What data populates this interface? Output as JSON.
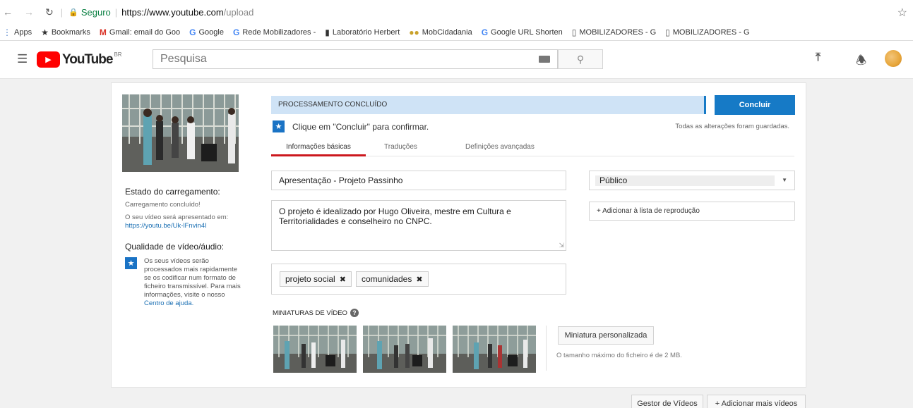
{
  "browser": {
    "secure_label": "Seguro",
    "url_host": "https://www.youtube.com",
    "url_path": "/upload",
    "bookmarks": [
      {
        "icon": "apps-icon",
        "label": "Apps"
      },
      {
        "icon": "star-icon",
        "label": "Bookmarks"
      },
      {
        "icon": "gmail-icon",
        "label": "Gmail: email do Goo"
      },
      {
        "icon": "google-icon",
        "label": "Google"
      },
      {
        "icon": "google-icon",
        "label": "Rede Mobilizadores -"
      },
      {
        "icon": "page-icon",
        "label": "Laboratório Herbert"
      },
      {
        "icon": "people-icon",
        "label": "MobCidadania"
      },
      {
        "icon": "google-icon",
        "label": "Google URL Shorten"
      },
      {
        "icon": "doc-icon",
        "label": "MOBILIZADORES - G"
      },
      {
        "icon": "doc-icon",
        "label": "MOBILIZADORES - G"
      }
    ]
  },
  "header": {
    "logo_text": "YouTube",
    "region": "BR",
    "search_placeholder": "Pesquisa"
  },
  "status": {
    "processing_label": "PROCESSAMENTO CONCLUÍDO",
    "confirm_hint": "Clique em \"Concluir\" para confirmar.",
    "saved_text": "Todas as alterações foram guardadas.",
    "conclude_button": "Concluir"
  },
  "tabs": [
    {
      "label": "Informações básicas",
      "active": true
    },
    {
      "label": "Traduções",
      "active": false
    },
    {
      "label": "Definições avançadas",
      "active": false
    }
  ],
  "sidebar": {
    "upload_state_title": "Estado do carregamento:",
    "upload_state_value": "Carregamento concluído!",
    "video_url_intro": "O seu vídeo será apresentado em:",
    "video_url": "https://youtu.be/Uk-lFnvin4I",
    "quality_title": "Qualidade de vídeo/áudio:",
    "quality_text": "Os seus vídeos serão processados mais rapidamente se os codificar num formato de ficheiro transmissível. Para mais informações, visite o nosso",
    "help_link": "Centro de ajuda."
  },
  "form": {
    "title_value": "Apresentação - Projeto Passinho",
    "description_value": "O projeto é idealizado por Hugo Oliveira, mestre em Cultura e Territorialidades e conselheiro no CNPC.",
    "tags": [
      "projeto social",
      "comunidades"
    ],
    "privacy_value": "Público",
    "add_playlist_button": "+ Adicionar à lista de reprodução"
  },
  "thumbnails": {
    "section_title": "MINIATURAS DE VÍDEO",
    "custom_button": "Miniatura personalizada",
    "max_size_note": "O tamanho máximo do ficheiro é de 2 MB."
  },
  "footer": {
    "video_manager_button": "Gestor de Vídeos",
    "add_more_button": "+ Adicionar mais vídeos"
  },
  "colors": {
    "youtube_red": "#ff0000",
    "accent_blue": "#167ac6",
    "status_bg": "#cfe3f6",
    "tab_active": "#cc181e"
  }
}
